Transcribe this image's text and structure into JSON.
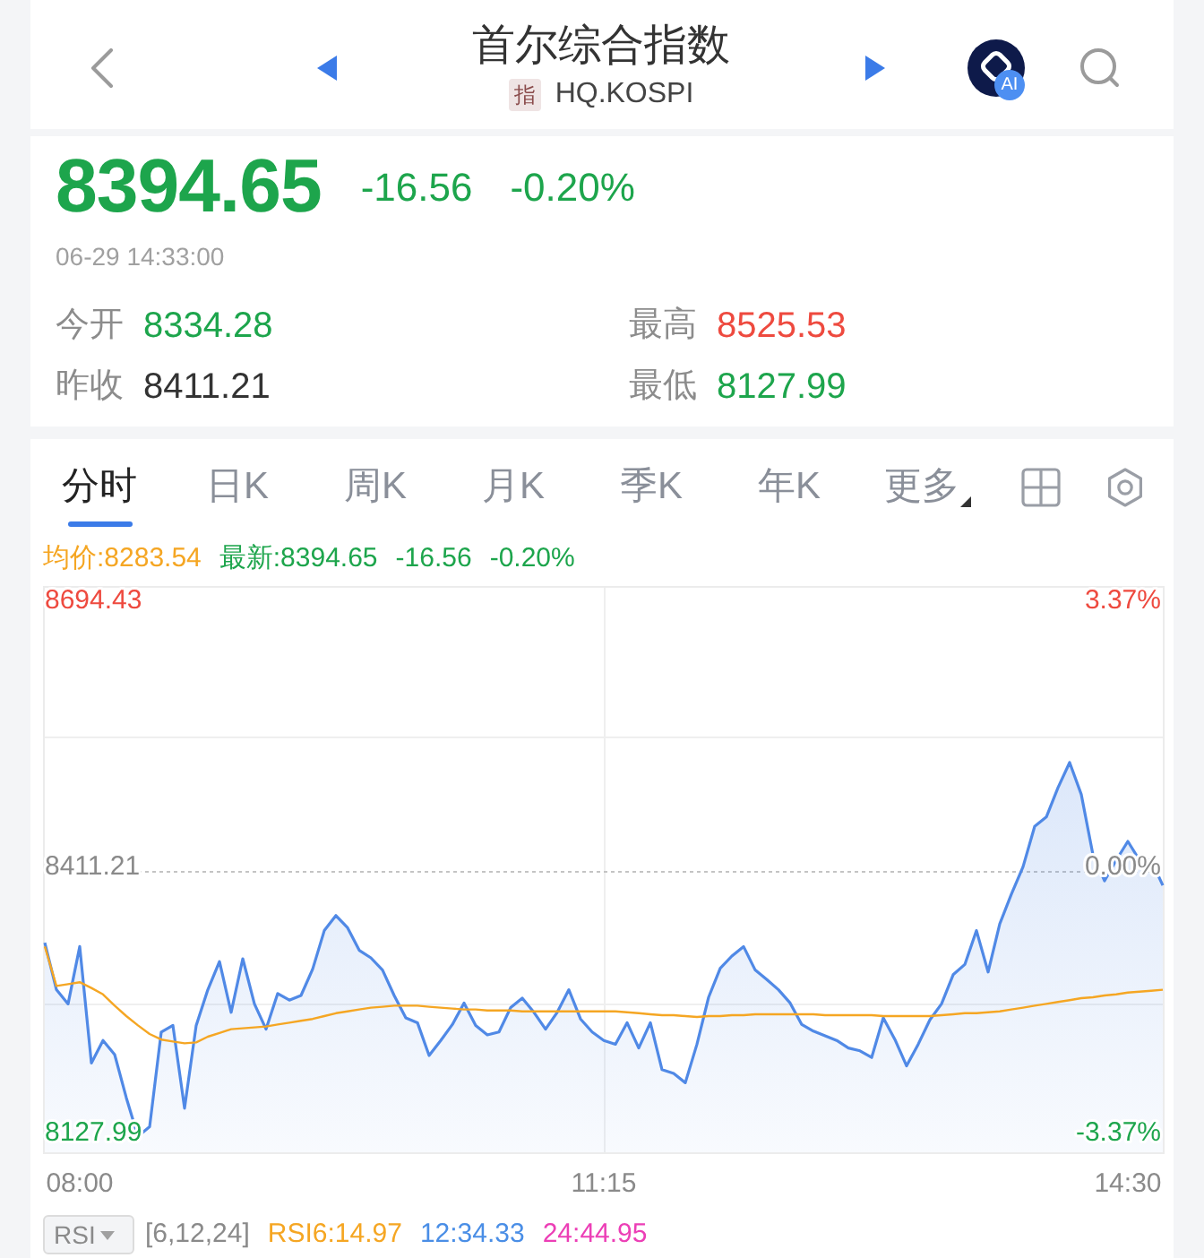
{
  "header": {
    "title": "首尔综合指数",
    "badge": "指",
    "code": "HQ.KOSPI",
    "ai_badge": "AI"
  },
  "quote": {
    "price": "8394.65",
    "change": "-16.56",
    "change_percent": "-0.20%",
    "rising": false,
    "time": "06-29 14:33:00"
  },
  "stats": [
    {
      "label": "今开",
      "value": "8334.28",
      "color": "#1da54c"
    },
    {
      "label": "最高",
      "value": "8525.53",
      "color": "#ee4a3f"
    },
    {
      "label": "昨收",
      "value": "8411.21",
      "color": "#333333"
    },
    {
      "label": "最低",
      "value": "8127.99",
      "color": "#1da54c"
    }
  ],
  "tabs": [
    {
      "label": "分时",
      "kind": "period",
      "selected": true
    },
    {
      "label": "日K",
      "kind": "period",
      "selected": false
    },
    {
      "label": "周K",
      "kind": "period",
      "selected": false
    },
    {
      "label": "月K",
      "kind": "period",
      "selected": false
    },
    {
      "label": "季K",
      "kind": "period",
      "selected": false
    },
    {
      "label": "年K",
      "kind": "period",
      "selected": false
    },
    {
      "label": "更多",
      "kind": "menu",
      "selected": false
    }
  ],
  "legend": [
    {
      "text": "均价:8283.54",
      "color": "#f5a623"
    },
    {
      "text": "最新:8394.65",
      "color": "#1da54c"
    },
    {
      "text": "-16.56",
      "color": "#1da54c"
    },
    {
      "text": "-0.20%",
      "color": "#1da54c"
    }
  ],
  "chart": {
    "percent_labels": [
      "3.37%",
      "0.00%",
      "-3.37%"
    ],
    "chart_data": {
      "type": "area",
      "categories": [
        null,
        null,
        null,
        "08:00",
        null,
        null,
        null,
        null,
        null,
        null,
        null,
        null,
        null,
        null,
        null,
        null,
        null,
        null,
        null,
        null,
        null,
        null,
        null,
        null,
        null,
        null,
        null,
        null,
        null,
        null,
        null,
        null,
        null,
        null,
        null,
        null,
        null,
        null,
        null,
        null,
        null,
        null,
        null,
        null,
        null,
        null,
        null,
        null,
        "11:15",
        null,
        null,
        null,
        null,
        null,
        null,
        null,
        null,
        null,
        null,
        null,
        null,
        null,
        null,
        null,
        null,
        null,
        null,
        null,
        null,
        null,
        null,
        null,
        null,
        null,
        null,
        null,
        null,
        null,
        null,
        null,
        null,
        null,
        null,
        null,
        null,
        null,
        null,
        null,
        null,
        null,
        null,
        null,
        null,
        "14:30",
        null,
        null,
        null
      ],
      "series": [
        {
          "color": "#5089e6",
          "values": [
            8334,
            8284,
            8269,
            8330,
            8206,
            8230,
            8215,
            8169,
            8128,
            8138,
            8239,
            8246,
            8158,
            8246,
            8284,
            8314,
            8260,
            8317,
            8269,
            8242,
            8280,
            8273,
            8278,
            8306,
            8347,
            8363,
            8350,
            8326,
            8318,
            8305,
            8278,
            8254,
            8249,
            8214,
            8230,
            8247,
            8270,
            8246,
            8236,
            8239,
            8265,
            8275,
            8260,
            8242,
            8260,
            8284,
            8253,
            8239,
            8230,
            8226,
            8249,
            8222,
            8249,
            8199,
            8195,
            8185,
            8226,
            8276,
            8307,
            8320,
            8330,
            8305,
            8295,
            8284,
            8270,
            8247,
            8240,
            8235,
            8230,
            8222,
            8219,
            8212,
            8254,
            8231,
            8203,
            8226,
            8252,
            8269,
            8300,
            8311,
            8347,
            8303,
            8354,
            8386,
            8415,
            8458,
            8468,
            8499,
            8526,
            8492,
            8428,
            8400,
            8422,
            8442,
            8422,
            8422,
            8395
          ]
        },
        {
          "type": "line",
          "color": "#f5a623",
          "values": [
            8330,
            8288,
            8290,
            8292,
            8286,
            8279,
            8267,
            8256,
            8246,
            8237,
            8231,
            8229,
            8227,
            8228,
            8234,
            8238,
            8242,
            8243,
            8244,
            8245,
            8247,
            8249,
            8251,
            8253,
            8256,
            8259,
            8261,
            8263,
            8265,
            8266,
            8267,
            8267,
            8267,
            8266,
            8265,
            8264,
            8263,
            8263,
            8262,
            8262,
            8262,
            8261,
            8261,
            8261,
            8261,
            8261,
            8261,
            8261,
            8261,
            8261,
            8260,
            8259,
            8258,
            8257,
            8257,
            8256,
            8255,
            8256,
            8256,
            8257,
            8257,
            8258,
            8258,
            8258,
            8258,
            8258,
            8258,
            8257,
            8257,
            8257,
            8257,
            8257,
            8256,
            8256,
            8256,
            8256,
            8256,
            8257,
            8258,
            8259,
            8259,
            8260,
            8261,
            8263,
            8265,
            8267,
            8269,
            8271,
            8273,
            8275,
            8276,
            8278,
            8279,
            8281,
            8282,
            8283,
            8284
          ]
        }
      ],
      "ylim": [
        8111,
        8712
      ],
      "yticks": [
        {
          "value": 8127.99,
          "label": "8127.99"
        },
        {
          "value": 8411.21,
          "label": "8411.21"
        },
        {
          "value": 8694.43,
          "label": "8694.43"
        }
      ],
      "ref_lines": [
        {
          "axis": "y",
          "value": 8411.21
        }
      ]
    }
  },
  "indicator": {
    "selector": "RSI",
    "params": "[6,12,24]",
    "values": [
      {
        "text": "RSI6:14.97",
        "color": "#f5a623"
      },
      {
        "text": "12:34.33",
        "color": "#4a8ee6"
      },
      {
        "text": "24:44.95",
        "color": "#ec3fb6"
      }
    ]
  }
}
